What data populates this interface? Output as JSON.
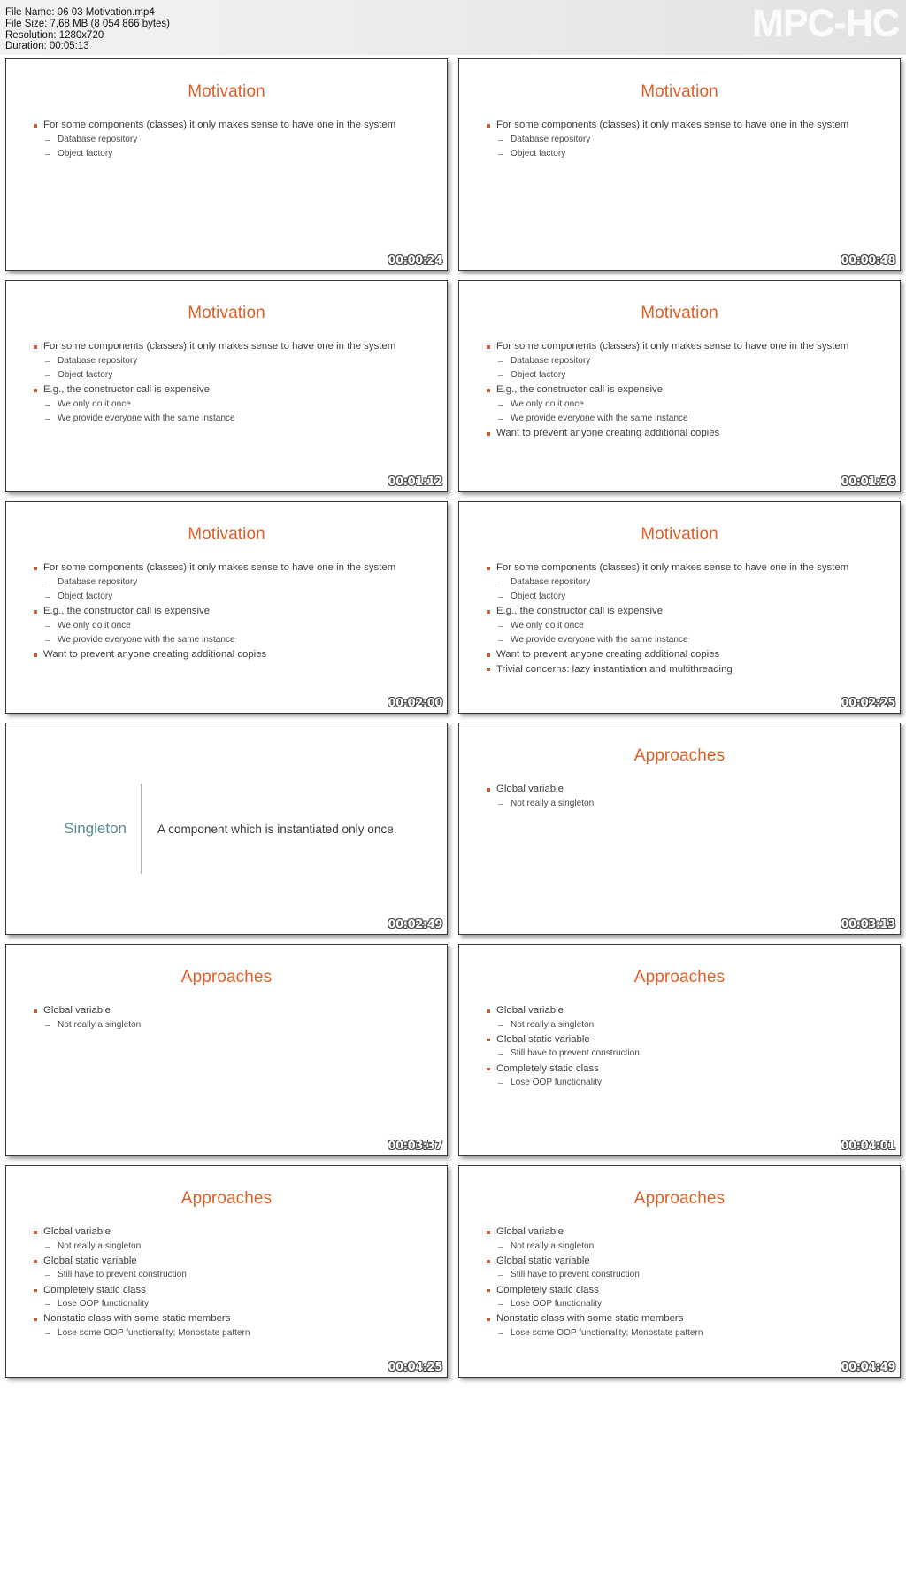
{
  "header": {
    "file_name_label": "File Name: 06 03 Motivation.mp4",
    "file_size_label": "File Size: 7,68 MB (8 054 866 bytes)",
    "resolution_label": "Resolution: 1280x720",
    "duration_label": "Duration: 00:05:13",
    "watermark": "MPC-HC"
  },
  "colors": {
    "title_orange": "#e06027",
    "bullet_orange": "#c0603b",
    "definition_teal": "#5b8c96",
    "body_gray": "#3f3f3f",
    "header_bg": "#ececec"
  },
  "thumbnails": [
    {
      "timestamp": "00:00:24",
      "kind": "bullets",
      "title": "Motivation",
      "bullets": [
        {
          "level": 1,
          "text": "For some components (classes) it only makes sense to have one in the system"
        },
        {
          "level": 2,
          "text": "Database repository"
        },
        {
          "level": 2,
          "text": "Object factory"
        }
      ]
    },
    {
      "timestamp": "00:00:48",
      "kind": "bullets",
      "title": "Motivation",
      "bullets": [
        {
          "level": 1,
          "text": "For some components (classes) it only makes sense to have one in the system"
        },
        {
          "level": 2,
          "text": "Database repository"
        },
        {
          "level": 2,
          "text": "Object factory"
        }
      ]
    },
    {
      "timestamp": "00:01:12",
      "kind": "bullets",
      "title": "Motivation",
      "bullets": [
        {
          "level": 1,
          "text": "For some components (classes) it only makes sense to have one in the system"
        },
        {
          "level": 2,
          "text": "Database repository"
        },
        {
          "level": 2,
          "text": "Object factory"
        },
        {
          "level": 1,
          "text": "E.g., the constructor call is expensive"
        },
        {
          "level": 2,
          "text": "We only do it once"
        },
        {
          "level": 2,
          "text": "We provide everyone with the same instance"
        }
      ]
    },
    {
      "timestamp": "00:01:36",
      "kind": "bullets",
      "title": "Motivation",
      "bullets": [
        {
          "level": 1,
          "text": "For some components (classes) it only makes sense to have one in the system"
        },
        {
          "level": 2,
          "text": "Database repository"
        },
        {
          "level": 2,
          "text": "Object factory"
        },
        {
          "level": 1,
          "text": "E.g., the constructor call is expensive"
        },
        {
          "level": 2,
          "text": "We only do it once"
        },
        {
          "level": 2,
          "text": "We provide everyone with the same instance"
        },
        {
          "level": 1,
          "text": "Want to prevent anyone creating additional copies"
        }
      ]
    },
    {
      "timestamp": "00:02:00",
      "kind": "bullets",
      "title": "Motivation",
      "bullets": [
        {
          "level": 1,
          "text": "For some components (classes) it only makes sense to have one in the system"
        },
        {
          "level": 2,
          "text": "Database repository"
        },
        {
          "level": 2,
          "text": "Object factory"
        },
        {
          "level": 1,
          "text": "E.g., the constructor call is expensive"
        },
        {
          "level": 2,
          "text": "We only do it once"
        },
        {
          "level": 2,
          "text": "We provide everyone with the same instance"
        },
        {
          "level": 1,
          "text": "Want to prevent anyone creating additional copies"
        }
      ]
    },
    {
      "timestamp": "00:02:25",
      "kind": "bullets",
      "title": "Motivation",
      "bullets": [
        {
          "level": 1,
          "text": "For some components (classes) it only makes sense to have one in the system"
        },
        {
          "level": 2,
          "text": "Database repository"
        },
        {
          "level": 2,
          "text": "Object factory"
        },
        {
          "level": 1,
          "text": "E.g., the constructor call is expensive"
        },
        {
          "level": 2,
          "text": "We only do it once"
        },
        {
          "level": 2,
          "text": "We provide everyone with the same instance"
        },
        {
          "level": 1,
          "text": "Want to prevent anyone creating additional copies"
        },
        {
          "level": 1,
          "text": "Trivial concerns: lazy instantiation and multithreading"
        }
      ]
    },
    {
      "timestamp": "00:02:49",
      "kind": "definition",
      "term": "Singleton",
      "definition": "A component which is instantiated only once."
    },
    {
      "timestamp": "00:03:13",
      "kind": "bullets",
      "title": "Approaches",
      "bullets": [
        {
          "level": 1,
          "text": "Global variable"
        },
        {
          "level": 2,
          "text": "Not really a singleton"
        }
      ]
    },
    {
      "timestamp": "00:03:37",
      "kind": "bullets",
      "title": "Approaches",
      "bullets": [
        {
          "level": 1,
          "text": "Global variable"
        },
        {
          "level": 2,
          "text": "Not really a singleton"
        }
      ]
    },
    {
      "timestamp": "00:04:01",
      "kind": "bullets",
      "title": "Approaches",
      "bullets": [
        {
          "level": 1,
          "text": "Global variable"
        },
        {
          "level": 2,
          "text": "Not really a singleton"
        },
        {
          "level": 1,
          "text": "Global static variable"
        },
        {
          "level": 2,
          "text": "Still have to prevent construction"
        },
        {
          "level": 1,
          "text": "Completely static class"
        },
        {
          "level": 2,
          "text": "Lose OOP functionality"
        }
      ]
    },
    {
      "timestamp": "00:04:25",
      "kind": "bullets",
      "title": "Approaches",
      "bullets": [
        {
          "level": 1,
          "text": "Global variable"
        },
        {
          "level": 2,
          "text": "Not really a singleton"
        },
        {
          "level": 1,
          "text": "Global static variable"
        },
        {
          "level": 2,
          "text": "Still have to prevent construction"
        },
        {
          "level": 1,
          "text": "Completely static class"
        },
        {
          "level": 2,
          "text": "Lose OOP functionality"
        },
        {
          "level": 1,
          "text": "Nonstatic class with some static members"
        },
        {
          "level": 2,
          "text": "Lose some OOP functionality; Monostate pattern"
        }
      ]
    },
    {
      "timestamp": "00:04:49",
      "kind": "bullets",
      "title": "Approaches",
      "bullets": [
        {
          "level": 1,
          "text": "Global variable"
        },
        {
          "level": 2,
          "text": "Not really a singleton"
        },
        {
          "level": 1,
          "text": "Global static variable"
        },
        {
          "level": 2,
          "text": "Still have to prevent construction"
        },
        {
          "level": 1,
          "text": "Completely static class"
        },
        {
          "level": 2,
          "text": "Lose OOP functionality"
        },
        {
          "level": 1,
          "text": "Nonstatic class with some static members"
        },
        {
          "level": 2,
          "text": "Lose some OOP functionality; Monostate pattern"
        }
      ]
    }
  ]
}
